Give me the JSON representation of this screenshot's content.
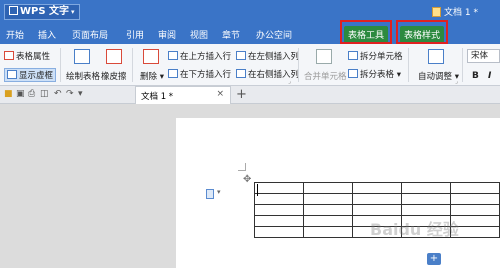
{
  "titlebar": {
    "app_name": "WPS 文字",
    "dropdown": "▾",
    "doc_title": "文档 1 *"
  },
  "menu": {
    "items": [
      "开始",
      "插入",
      "页面布局",
      "引用",
      "审阅",
      "视图",
      "章节",
      "办公空间"
    ],
    "table_tools": "表格工具",
    "table_style": "表格样式"
  },
  "ribbon": {
    "table_props": "表格属性",
    "show_gridlines": "显示虚框",
    "draw_table": "绘制表格",
    "eraser": "橡皮擦",
    "delete": "删除",
    "insert_above": "在上方插入行",
    "insert_below": "在下方插入行",
    "insert_left": "在左侧插入列",
    "insert_right": "在右侧插入列",
    "merge_cells": "合并单元格",
    "split_cells": "拆分单元格",
    "split_table": "拆分表格",
    "auto_fit": "自动调整",
    "font": "宋体",
    "bold": "B",
    "italic": "I"
  },
  "tabs": {
    "doc_tab": "文档 1 *",
    "close": "×",
    "new": "+"
  },
  "document": {
    "watermark": "Baidu 经验",
    "table_rows": 5,
    "table_cols": 5
  },
  "colors": {
    "titlebar": "#3a74c7",
    "context_tab": "#2c8a3f",
    "highlight": "#e02020"
  }
}
